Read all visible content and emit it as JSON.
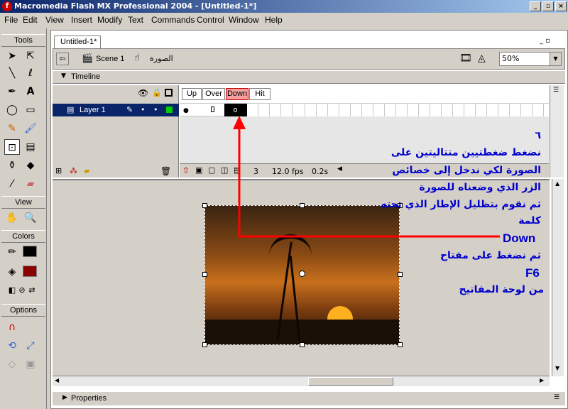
{
  "window": {
    "title": "Macromedia Flash MX Professional 2004 - [Untitled-1*]",
    "min": "_",
    "restore": "▫",
    "close": "×"
  },
  "menu": [
    "File",
    "Edit",
    "View",
    "Insert",
    "Modify",
    "Text",
    "Commands",
    "Control",
    "Window",
    "Help"
  ],
  "toolbox": {
    "tools_label": "Tools",
    "view_label": "View",
    "colors_label": "Colors",
    "options_label": "Options"
  },
  "document": {
    "tab": "Untitled-1*",
    "scene": "Scene 1",
    "symbol": "الصورة",
    "zoom": "50%"
  },
  "timeline": {
    "label": "Timeline",
    "layer_name": "Layer 1",
    "states": [
      "Up",
      "Over",
      "Down",
      "Hit"
    ],
    "frame_num": "3",
    "fps": "12.0 fps",
    "time": "0.2s"
  },
  "instructions": {
    "step": "٦",
    "line1": "نضغط ضغطتيين متتاليتين على",
    "line2": "الصورة لكي ندخل إلى خصائص",
    "line3": "الزر الذي وضعناه للصورة",
    "line4": "ثم نقوم بتظليل الإطار الذي تحته",
    "line5": "كلمة",
    "word_down": "Down",
    "line6": "ثم نضغط على مفتاح",
    "word_f6": "F6",
    "line7": "من لوحة المفاتيح"
  },
  "properties": {
    "label": "Properties"
  },
  "colors": {
    "title_start": "#0a246a",
    "title_end": "#a6caf0",
    "annotation_arrow": "#ff0000",
    "annotation_text": "#0000cc"
  }
}
